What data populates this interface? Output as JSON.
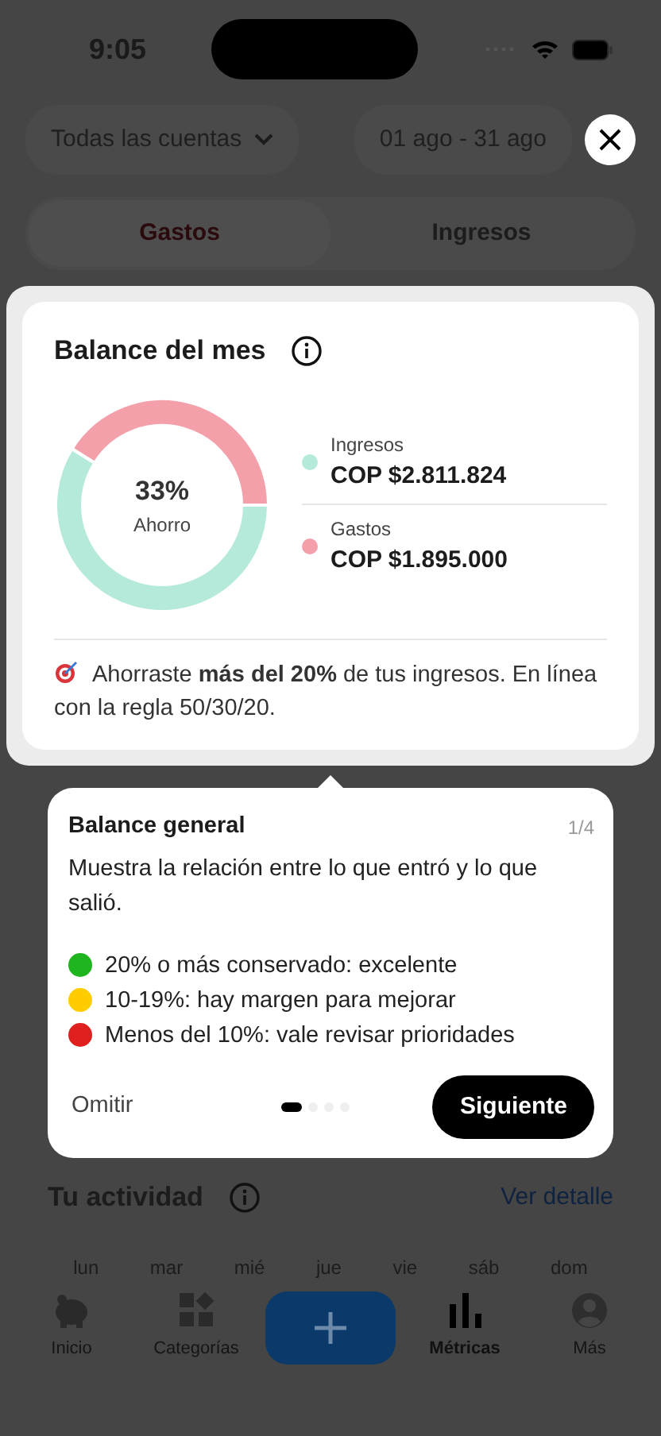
{
  "status_bar": {
    "time": "9:05"
  },
  "filters": {
    "account": "Todas las cuentas",
    "date_range": "01 ago - 31 ago"
  },
  "tabs": [
    {
      "label": "Gastos",
      "selected": true
    },
    {
      "label": "Ingresos",
      "selected": false
    }
  ],
  "balance_card": {
    "title": "Balance del mes",
    "center_value": "33%",
    "center_label": "Ahorro",
    "legend": [
      {
        "label": "Ingresos",
        "amount": "COP $2.811.824",
        "color": "#b5eadb"
      },
      {
        "label": "Gastos",
        "amount": "COP $1.895.000",
        "color": "#f4a0aa"
      }
    ],
    "insight": "Ahorraste **más del 20%** de tus ingresos. En línea con la regla 50/30/20."
  },
  "tooltip": {
    "title": "Balance general",
    "step": "1/4",
    "body": "Muestra la relación entre lo que entró y lo que salió.",
    "rules": [
      {
        "text": "20% o más conservado: excelente",
        "color": "#1fb51f"
      },
      {
        "text": "10-19%: hay margen para mejorar",
        "color": "#ffcc00"
      },
      {
        "text": "Menos del 10%: vale revisar prioridades",
        "color": "#e0201f"
      }
    ],
    "skip": "Omitir",
    "pages": [
      {
        "selected": true
      },
      {
        "selected": false
      },
      {
        "selected": false
      },
      {
        "selected": false
      }
    ],
    "next": "Siguiente"
  },
  "activity": {
    "title": "Tu actividad",
    "link": "Ver detalle",
    "days": [
      "lun",
      "mar",
      "mié",
      "jue",
      "vie",
      "sáb",
      "dom"
    ]
  },
  "nav": [
    {
      "kind": "tab",
      "label": "Inicio",
      "selected": false
    },
    {
      "kind": "tab",
      "label": "Categorías",
      "selected": false
    },
    {
      "kind": "add"
    },
    {
      "kind": "tab",
      "label": "Métricas",
      "selected": true
    },
    {
      "kind": "tab",
      "label": "Más",
      "selected": false
    }
  ]
}
